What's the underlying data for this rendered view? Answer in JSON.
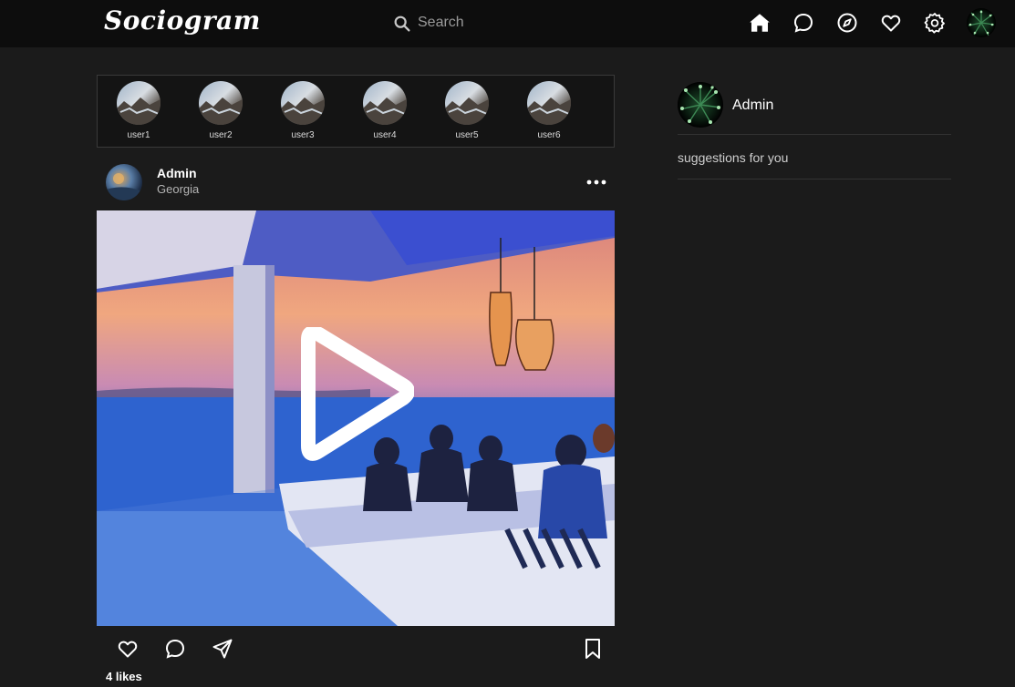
{
  "header": {
    "logo": "Sociogram",
    "search": {
      "placeholder": "Search",
      "value": ""
    },
    "nav_icons": [
      "home-icon",
      "chat-icon",
      "compass-icon",
      "heart-icon",
      "settings-icon"
    ]
  },
  "stories": [
    {
      "username": "user1"
    },
    {
      "username": "user2"
    },
    {
      "username": "user3"
    },
    {
      "username": "user4"
    },
    {
      "username": "user5"
    },
    {
      "username": "user6"
    }
  ],
  "post": {
    "username": "Admin",
    "location": "Georgia",
    "media_type": "video",
    "likes": "4 likes"
  },
  "sidebar": {
    "profile_name": "Admin",
    "suggestions_label": "suggestions for you"
  },
  "colors": {
    "background": "#1b1b1b",
    "topbar": "#0d0d0d",
    "text": "#ffffff",
    "muted": "#b5b5b5"
  }
}
